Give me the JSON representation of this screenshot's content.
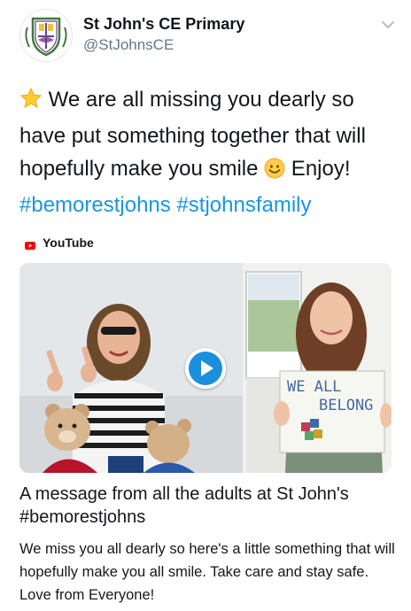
{
  "account": {
    "name": "St John's CE Primary",
    "handle": "@StJohnsCE",
    "avatar_icon": "school-crest-icon",
    "menu_icon": "chevron-down-icon"
  },
  "tweet": {
    "text_part1": "We are all missing you dearly so have put something together that will hopefully make you smile ",
    "text_part2": " Enjoy!",
    "hashtag1": "#bemorestjohns",
    "hashtag2": "#stjohnsfamily",
    "emoji_leading": "star-emoji",
    "emoji_inline": "smiling-face-emoji"
  },
  "card": {
    "source": "YouTube",
    "source_icon": "youtube-icon",
    "thumbnail_sign_line1": "WE ALL",
    "thumbnail_sign_line2": "BELONG",
    "title": "A message from all the adults at St John's #bemorestjohns",
    "description": "We miss you all dearly so here's a little something that will hopefully make you all smile. Take care and stay safe. Love from Everyone!"
  },
  "colors": {
    "link": "#1b95e0",
    "play_button": "#1b8fde",
    "youtube_red": "#ff0000",
    "crest_purple": "#6b3f8f",
    "crest_green": "#3f7a3a"
  }
}
